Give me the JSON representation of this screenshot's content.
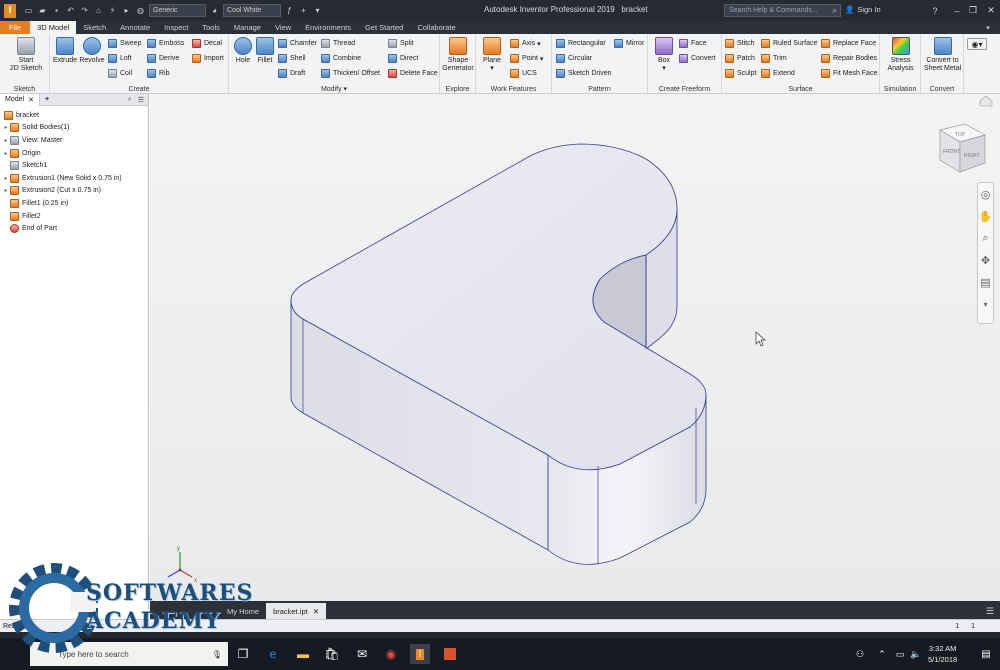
{
  "app": {
    "title": "Autodesk Inventor Professional 2019",
    "document": "bracket",
    "search_placeholder": "Search Help & Commands...",
    "sign_in": "Sign In",
    "quick_access": {
      "material": "Generic",
      "appearance": "Cool White"
    }
  },
  "tabs": [
    "File",
    "3D Model",
    "Sketch",
    "Annotate",
    "Inspect",
    "Tools",
    "Manage",
    "View",
    "Environments",
    "Get Started",
    "Collaborate"
  ],
  "active_tab": "3D Model",
  "ribbon": {
    "sketch": {
      "label": "Sketch",
      "start": "Start\n2D Sketch"
    },
    "create": {
      "label": "Create",
      "extrude": "Extrude",
      "revolve": "Revolve",
      "sweep": "Sweep",
      "loft": "Loft",
      "coil": "Coil",
      "emboss": "Emboss",
      "derive": "Derive",
      "rib": "Rib",
      "decal": "Decal",
      "import": "Import"
    },
    "modify": {
      "label": "Modify",
      "hole": "Hole",
      "fillet": "Fillet",
      "chamfer": "Chamfer",
      "shell": "Shell",
      "draft": "Draft",
      "thread": "Thread",
      "combine": "Combine",
      "thicken": "Thicken/ Offset",
      "split": "Split",
      "direct": "Direct",
      "delete_face": "Delete Face"
    },
    "explore": {
      "label": "Explore",
      "shape_generator": "Shape\nGenerator"
    },
    "work_features": {
      "label": "Work Features",
      "plane": "Plane",
      "axis": "Axis",
      "point": "Point",
      "ucs": "UCS"
    },
    "pattern": {
      "label": "Pattern",
      "rectangular": "Rectangular",
      "circular": "Circular",
      "sketch_driven": "Sketch Driven",
      "mirror": "Mirror"
    },
    "create_freeform": {
      "label": "Create Freeform",
      "box": "Box",
      "face": "Face",
      "convert": "Convert"
    },
    "surface": {
      "label": "Surface",
      "stitch": "Stitch",
      "patch": "Patch",
      "sculpt": "Sculpt",
      "ruled_surface": "Ruled Surface",
      "trim": "Trim",
      "extend": "Extend",
      "replace_face": "Replace Face",
      "repair_bodies": "Repair Bodies",
      "fit_mesh_face": "Fit Mesh Face"
    },
    "simulation": {
      "label": "Simulation",
      "stress": "Stress\nAnalysis"
    },
    "convert": {
      "label": "Convert",
      "sheet_metal": "Convert to\nSheet Metal"
    }
  },
  "browser": {
    "tab": "Model",
    "tree": [
      {
        "label": "bracket",
        "icon": "part-icon",
        "expand": ""
      },
      {
        "label": "Solid Bodies(1)",
        "icon": "solid-bodies-icon",
        "expand": "+"
      },
      {
        "label": "View: Master",
        "icon": "view-icon",
        "expand": "+"
      },
      {
        "label": "Origin",
        "icon": "folder-icon",
        "expand": "+"
      },
      {
        "label": "Sketch1",
        "icon": "sketch-icon",
        "expand": ""
      },
      {
        "label": "Extrusion1 (New Solid x 0.75 in)",
        "icon": "extrude-icon",
        "expand": "+"
      },
      {
        "label": "Extrusion2 (Cut x 0.75 in)",
        "icon": "extrude-icon",
        "expand": "+"
      },
      {
        "label": "Fillet1 (0.25 in)",
        "icon": "fillet-icon",
        "expand": ""
      },
      {
        "label": "Fillet2",
        "icon": "fillet-icon",
        "expand": ""
      },
      {
        "label": "End of Part",
        "icon": "end-of-part-icon",
        "expand": ""
      }
    ]
  },
  "viewcube": {
    "top": "TOP",
    "front": "FRONT",
    "right": "RIGHT"
  },
  "doc_tabs": [
    "My Home",
    "bracket.ipt"
  ],
  "status": {
    "text": "Ready",
    "count_a": "1",
    "count_b": "1"
  },
  "taskbar": {
    "search": "Type here to search",
    "time": "3:32 AM",
    "date": "5/1/2018"
  },
  "watermark": {
    "line1": "SOFTWARES",
    "line2": "ACADEMY"
  },
  "colors": {
    "accent": "#E67D22",
    "title_bar": "#252A33",
    "part_face": "#E4E4EE",
    "edge": "#3A3A8C"
  }
}
